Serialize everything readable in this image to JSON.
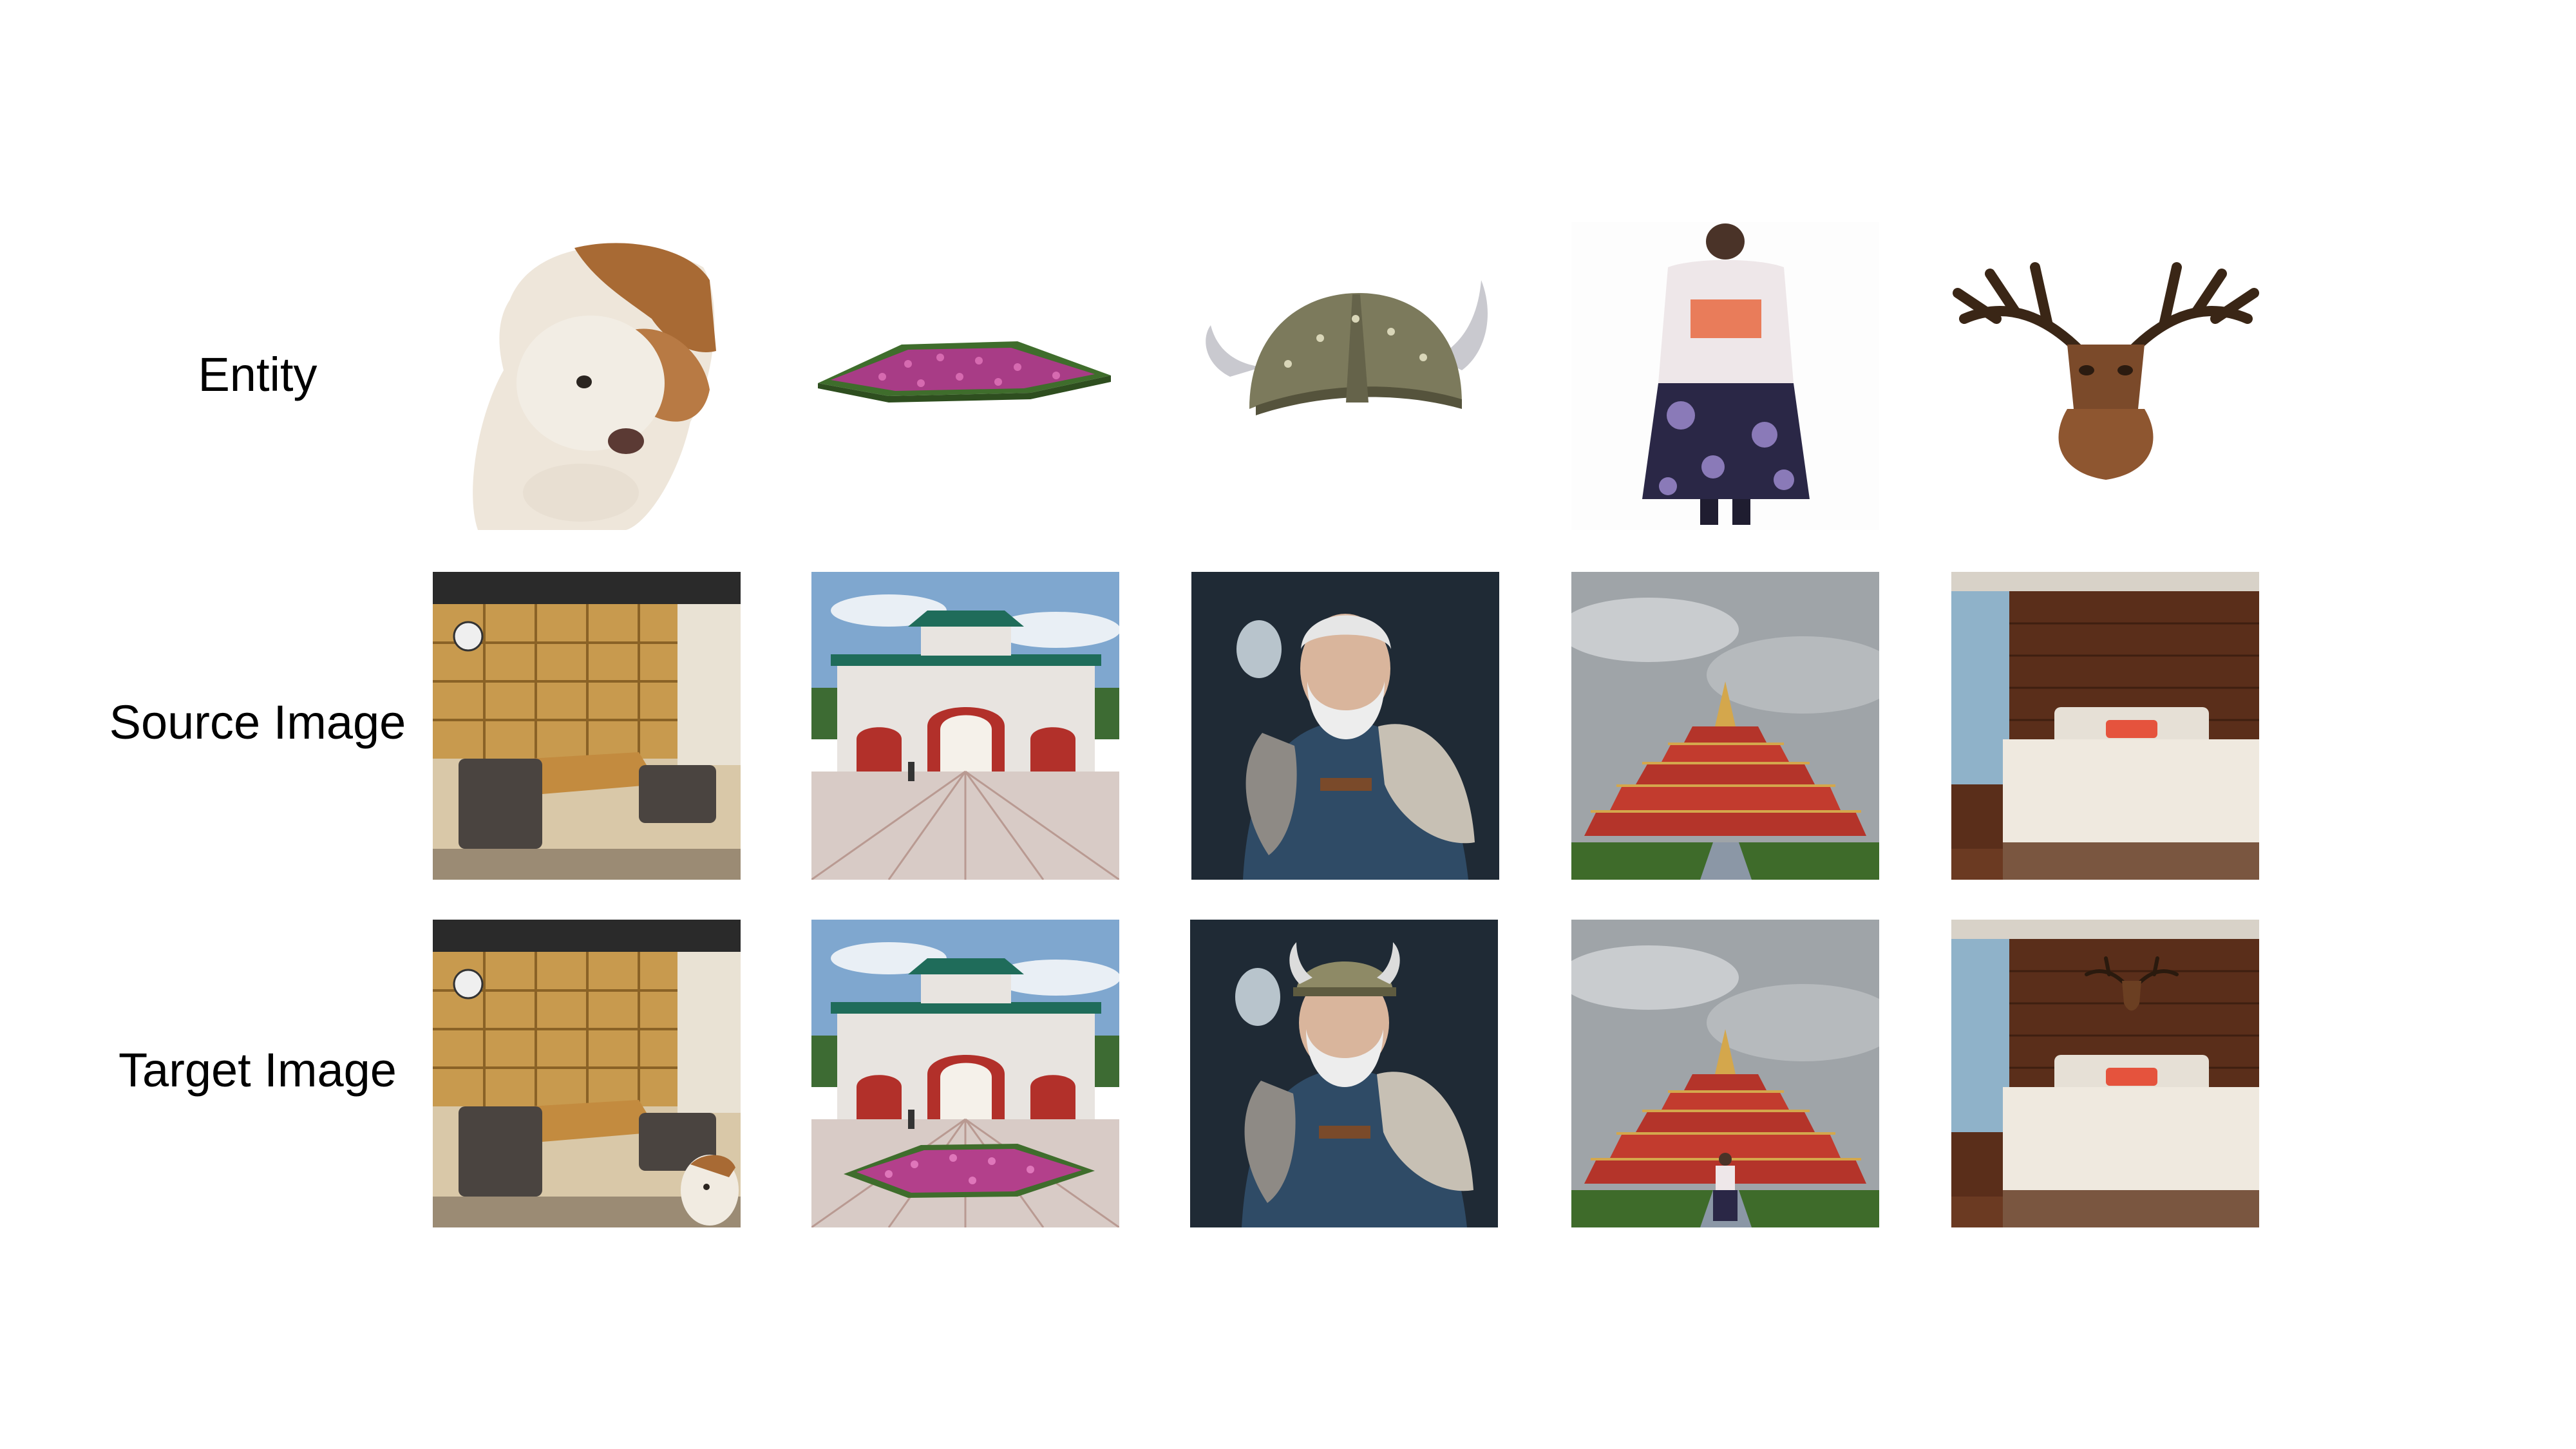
{
  "figure": {
    "row_labels": {
      "entity": "Entity",
      "source": "Source Image",
      "target": "Target Image"
    },
    "columns": [
      {
        "entity": "dog-entity",
        "source": "furniture-store-scene",
        "target": "furniture-store-with-dog"
      },
      {
        "entity": "flowerbed-entity",
        "source": "chinese-gate-plaza",
        "target": "gate-plaza-with-flowerbed"
      },
      {
        "entity": "viking-helmet-entity",
        "source": "old-warrior-portrait",
        "target": "warrior-with-viking-helmet"
      },
      {
        "entity": "kimono-woman-entity",
        "source": "tiered-pagoda-scene",
        "target": "pagoda-with-kimono-woman"
      },
      {
        "entity": "deer-head-trophy-entity",
        "source": "hotel-bedroom",
        "target": "bedroom-with-deer-head"
      }
    ]
  }
}
